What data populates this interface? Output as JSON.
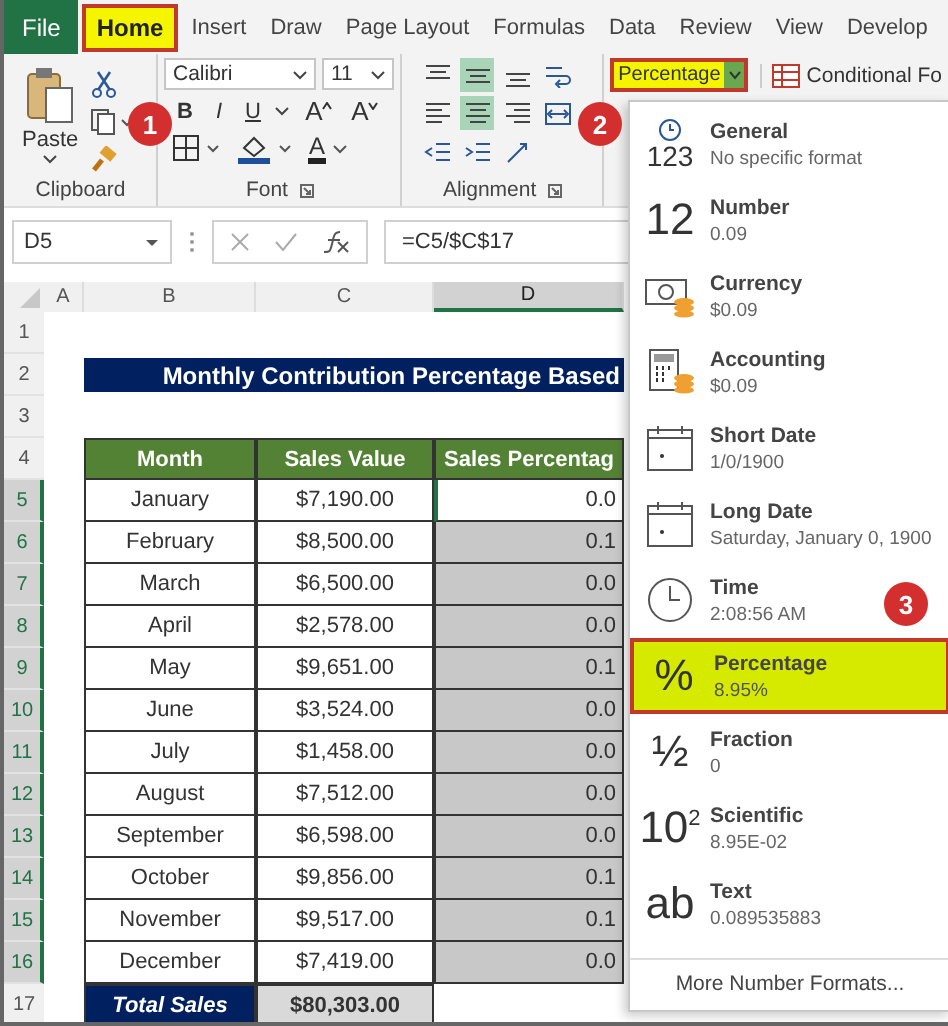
{
  "tabs": [
    {
      "label": "File",
      "kind": "file",
      "selected": false
    },
    {
      "label": "Home",
      "kind": "tab",
      "selected": true
    },
    {
      "label": "Insert",
      "kind": "tab",
      "selected": false
    },
    {
      "label": "Draw",
      "kind": "tab",
      "selected": false
    },
    {
      "label": "Page Layout",
      "kind": "tab",
      "selected": false
    },
    {
      "label": "Formulas",
      "kind": "tab",
      "selected": false
    },
    {
      "label": "Data",
      "kind": "tab",
      "selected": false
    },
    {
      "label": "Review",
      "kind": "tab",
      "selected": false
    },
    {
      "label": "View",
      "kind": "tab",
      "selected": false
    },
    {
      "label": "Develop",
      "kind": "tab",
      "selected": false
    }
  ],
  "ribbon": {
    "clipboard": {
      "paste_label": "Paste",
      "group_label": "Clipboard"
    },
    "font": {
      "font_name": "Calibri",
      "font_size": "11",
      "styles": [
        {
          "label": "B",
          "kind": "bold"
        },
        {
          "label": "I",
          "kind": "italic"
        },
        {
          "label": "U",
          "kind": "underline"
        }
      ],
      "size_buttons": [
        {
          "label": "A",
          "kind": "grow"
        },
        {
          "label": "A",
          "kind": "shrink"
        }
      ],
      "font_color_label": "A",
      "group_label": "Font"
    },
    "alignment": {
      "buttons": [
        {
          "kind": "top",
          "selected": false
        },
        {
          "kind": "middle",
          "selected": true
        },
        {
          "kind": "bottom",
          "selected": false
        },
        {
          "kind": "wrap",
          "selected": false
        },
        {
          "kind": "left",
          "selected": false
        },
        {
          "kind": "center",
          "selected": true
        },
        {
          "kind": "right",
          "selected": false
        },
        {
          "kind": "merge",
          "selected": false
        },
        {
          "kind": "outdent",
          "selected": false
        },
        {
          "kind": "indent",
          "selected": false
        },
        {
          "kind": "orientation",
          "selected": false
        }
      ],
      "group_label": "Alignment"
    },
    "number_format": "Percentage",
    "conditional_label": "Conditional Fo"
  },
  "formula_bar": {
    "name_box": "D5",
    "formula": "=C5/$C$17"
  },
  "sheet": {
    "columns": [
      {
        "label": "A",
        "selected": false
      },
      {
        "label": "B",
        "selected": false
      },
      {
        "label": "C",
        "selected": false
      },
      {
        "label": "D",
        "selected": true
      }
    ],
    "row_numbers": [
      {
        "label": "1",
        "selected": false
      },
      {
        "label": "2",
        "selected": false
      },
      {
        "label": "3",
        "selected": false
      },
      {
        "label": "4",
        "selected": false
      },
      {
        "label": "5",
        "selected": true
      },
      {
        "label": "6",
        "selected": true
      },
      {
        "label": "7",
        "selected": true
      },
      {
        "label": "8",
        "selected": true
      },
      {
        "label": "9",
        "selected": true
      },
      {
        "label": "10",
        "selected": true
      },
      {
        "label": "11",
        "selected": true
      },
      {
        "label": "12",
        "selected": true
      },
      {
        "label": "13",
        "selected": true
      },
      {
        "label": "14",
        "selected": true
      },
      {
        "label": "15",
        "selected": true
      },
      {
        "label": "16",
        "selected": true
      },
      {
        "label": "17",
        "selected": false
      }
    ],
    "title": "Monthly Contribution Percentage Based",
    "headers": [
      "Month",
      "Sales Value",
      "Sales Percentag"
    ],
    "rows": [
      {
        "month": "January",
        "sales": "$7,190.00",
        "percent": "0.0",
        "active": true
      },
      {
        "month": "February",
        "sales": "$8,500.00",
        "percent": "0.1",
        "active": false
      },
      {
        "month": "March",
        "sales": "$6,500.00",
        "percent": "0.0",
        "active": false
      },
      {
        "month": "April",
        "sales": "$2,578.00",
        "percent": "0.0",
        "active": false
      },
      {
        "month": "May",
        "sales": "$9,651.00",
        "percent": "0.1",
        "active": false
      },
      {
        "month": "June",
        "sales": "$3,524.00",
        "percent": "0.0",
        "active": false
      },
      {
        "month": "July",
        "sales": "$1,458.00",
        "percent": "0.0",
        "active": false
      },
      {
        "month": "August",
        "sales": "$7,512.00",
        "percent": "0.0",
        "active": false
      },
      {
        "month": "September",
        "sales": "$6,598.00",
        "percent": "0.0",
        "active": false
      },
      {
        "month": "October",
        "sales": "$9,856.00",
        "percent": "0.1",
        "active": false
      },
      {
        "month": "November",
        "sales": "$9,517.00",
        "percent": "0.1",
        "active": false
      },
      {
        "month": "December",
        "sales": "$7,419.00",
        "percent": "0.0",
        "active": false
      }
    ],
    "total": {
      "label": "Total Sales",
      "value": "$80,303.00"
    }
  },
  "format_menu": {
    "items": [
      {
        "kind": "general",
        "glyph": "123",
        "name": "General",
        "example": "No specific format",
        "selected": false
      },
      {
        "kind": "number",
        "glyph": "12",
        "name": "Number",
        "example": "0.09",
        "selected": false
      },
      {
        "kind": "currency",
        "name": "Currency",
        "example": "$0.09",
        "selected": false
      },
      {
        "kind": "accounting",
        "name": "Accounting",
        "example": "$0.09",
        "selected": false
      },
      {
        "kind": "short_date",
        "name": "Short Date",
        "example": "1/0/1900",
        "selected": false
      },
      {
        "kind": "long_date",
        "name": "Long Date",
        "example": "Saturday, January 0, 1900",
        "selected": false
      },
      {
        "kind": "time",
        "name": "Time",
        "example": "2:08:56 AM",
        "selected": false
      },
      {
        "kind": "percentage",
        "glyph": "%",
        "name": "Percentage",
        "example": "8.95%",
        "selected": true
      },
      {
        "kind": "fraction",
        "glyph": "½",
        "name": "Fraction",
        "example": "0",
        "selected": false
      },
      {
        "kind": "scientific",
        "glyph": "10$^{2}$",
        "name": "Scientific",
        "example": "8.95E-02",
        "selected": false
      },
      {
        "kind": "text",
        "glyph": "ab",
        "name": "Text",
        "example": "0.089535883",
        "selected": false
      }
    ],
    "more": "More Number Formats..."
  },
  "step_badges": [
    "1",
    "2",
    "3"
  ]
}
